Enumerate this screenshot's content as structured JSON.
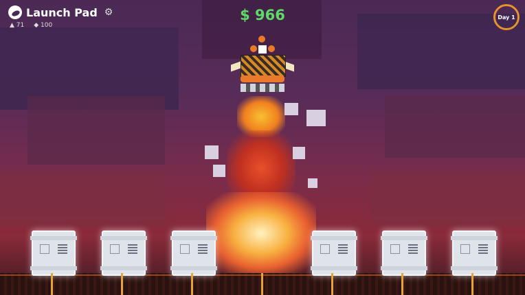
{
  "hud": {
    "title": "Launch Pad",
    "settings_icon": "gear-icon",
    "stat_altitude": "71",
    "stat_fuel": "100",
    "money": "$ 966",
    "day": "Day 1"
  },
  "colors": {
    "money": "#5fd86a",
    "day_ring": "#e8922c",
    "sky": "#5a2c58",
    "ground": "#2a1210"
  },
  "scene": {
    "buildings_count": 7
  }
}
